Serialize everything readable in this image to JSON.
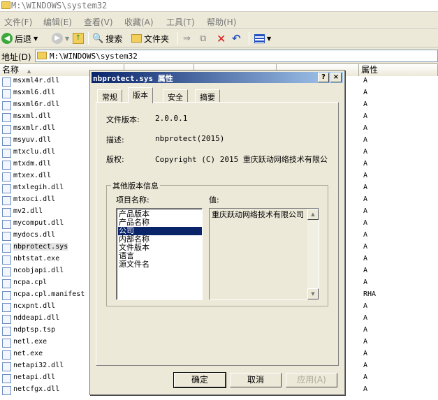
{
  "window": {
    "title": "M:\\WINDOWS\\system32"
  },
  "menu": [
    "文件(F)",
    "编辑(E)",
    "查看(V)",
    "收藏(A)",
    "工具(T)",
    "帮助(H)"
  ],
  "toolbar": {
    "back": "后退",
    "search": "搜索",
    "folders": "文件夹"
  },
  "address": {
    "label": "地址(D)",
    "value": "M:\\WINDOWS\\system32"
  },
  "columns": {
    "name": "名称",
    "attributes": "属性"
  },
  "files": [
    {
      "name": "msxml4r.dll",
      "attr": "A"
    },
    {
      "name": "msxml6.dll",
      "attr": "A"
    },
    {
      "name": "msxml6r.dll",
      "attr": "A"
    },
    {
      "name": "msxml.dll",
      "attr": "A"
    },
    {
      "name": "msxmlr.dll",
      "attr": "A"
    },
    {
      "name": "msyuv.dll",
      "attr": "A"
    },
    {
      "name": "mtxclu.dll",
      "attr": "A"
    },
    {
      "name": "mtxdm.dll",
      "attr": "A"
    },
    {
      "name": "mtxex.dll",
      "attr": "A"
    },
    {
      "name": "mtxlegih.dll",
      "attr": "A"
    },
    {
      "name": "mtxoci.dll",
      "attr": "A"
    },
    {
      "name": "mv2.dll",
      "attr": "A"
    },
    {
      "name": "mycomput.dll",
      "attr": "A"
    },
    {
      "name": "mydocs.dll",
      "attr": "A"
    },
    {
      "name": "nbprotect.sys",
      "attr": "A"
    },
    {
      "name": "nbtstat.exe",
      "attr": "A"
    },
    {
      "name": "ncobjapi.dll",
      "attr": "A"
    },
    {
      "name": "ncpa.cpl",
      "attr": "A"
    },
    {
      "name": "ncpa.cpl.manifest",
      "attr": "RHA"
    },
    {
      "name": "ncxpnt.dll",
      "attr": "A"
    },
    {
      "name": "nddeapi.dll",
      "attr": "A"
    },
    {
      "name": "ndptsp.tsp",
      "attr": "A"
    },
    {
      "name": "netl.exe",
      "attr": "A"
    },
    {
      "name": "net.exe",
      "attr": "A"
    },
    {
      "name": "netapi32.dll",
      "attr": "A"
    },
    {
      "name": "netapi.dll",
      "attr": "A"
    },
    {
      "name": "netcfgx.dll",
      "attr": "A"
    }
  ],
  "dialog": {
    "title": "nbprotect.sys 属性",
    "help_btn": "?",
    "close_btn": "×",
    "tabs": [
      "常规",
      "版本",
      "安全",
      "摘要"
    ],
    "file_version_label": "文件版本:",
    "file_version": "2.0.0.1",
    "description_label": "描述:",
    "description": "nbprotect(2015)",
    "copyright_label": "版权:",
    "copyright": "Copyright (C) 2015 重庆跃动网络技术有限公",
    "group_title": "其他版本信息",
    "item_name_label": "项目名称:",
    "value_label": "值:",
    "items": [
      "产品版本",
      "产品名称",
      "公司",
      "内部名称",
      "文件版本",
      "语言",
      "源文件名"
    ],
    "selected_value": "重庆跃动网络技术有限公司",
    "ok": "确定",
    "cancel": "取消",
    "apply": "应用(A)"
  }
}
